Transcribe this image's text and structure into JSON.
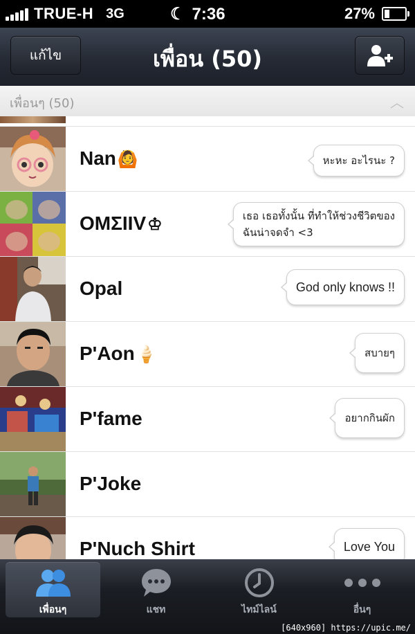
{
  "status_bar": {
    "carrier": "TRUE-H",
    "network": "3G",
    "time": "7:36",
    "battery": "27%"
  },
  "nav": {
    "edit_label": "แก้ไข",
    "title": "เพื่อน (50)",
    "add_icon": "add-friend-icon"
  },
  "section": {
    "label": "เพื่อนๆ (50)",
    "toggle_icon": "chevron-up-icon"
  },
  "friends": [
    {
      "name": "Nan",
      "emoji": "🙆",
      "status": "หะหะ อะไรนะ ?"
    },
    {
      "name": "OMΣIIV",
      "emoji": "♔",
      "status_line1": "เธอ เธอทั้งนั้น ที่ทำให้ช่วงชีวิตของ",
      "status_line2": "ฉันน่าจดจำ <3"
    },
    {
      "name": "Opal",
      "status": "God only knows !!"
    },
    {
      "name": "P'Aon",
      "emoji": "🍦",
      "status": "สบายๆ"
    },
    {
      "name": "P'fame",
      "status": "อยากกินผัก"
    },
    {
      "name": "P'Joke"
    },
    {
      "name": "P'Nuch Shirt",
      "status": "Love You"
    }
  ],
  "tabs": [
    {
      "label": "เพื่อนๆ",
      "icon": "friends-icon",
      "active": true
    },
    {
      "label": "แชท",
      "icon": "chat-icon"
    },
    {
      "label": "ไทม์ไลน์",
      "icon": "clock-icon"
    },
    {
      "label": "อื่นๆ",
      "icon": "more-icon"
    }
  ],
  "watermark": "[640x960] https://upic.me/",
  "colors": {
    "nav_bg": "#252a34",
    "tab_bg": "#1b1e24",
    "active_tab_icon": "#4a90e2"
  }
}
